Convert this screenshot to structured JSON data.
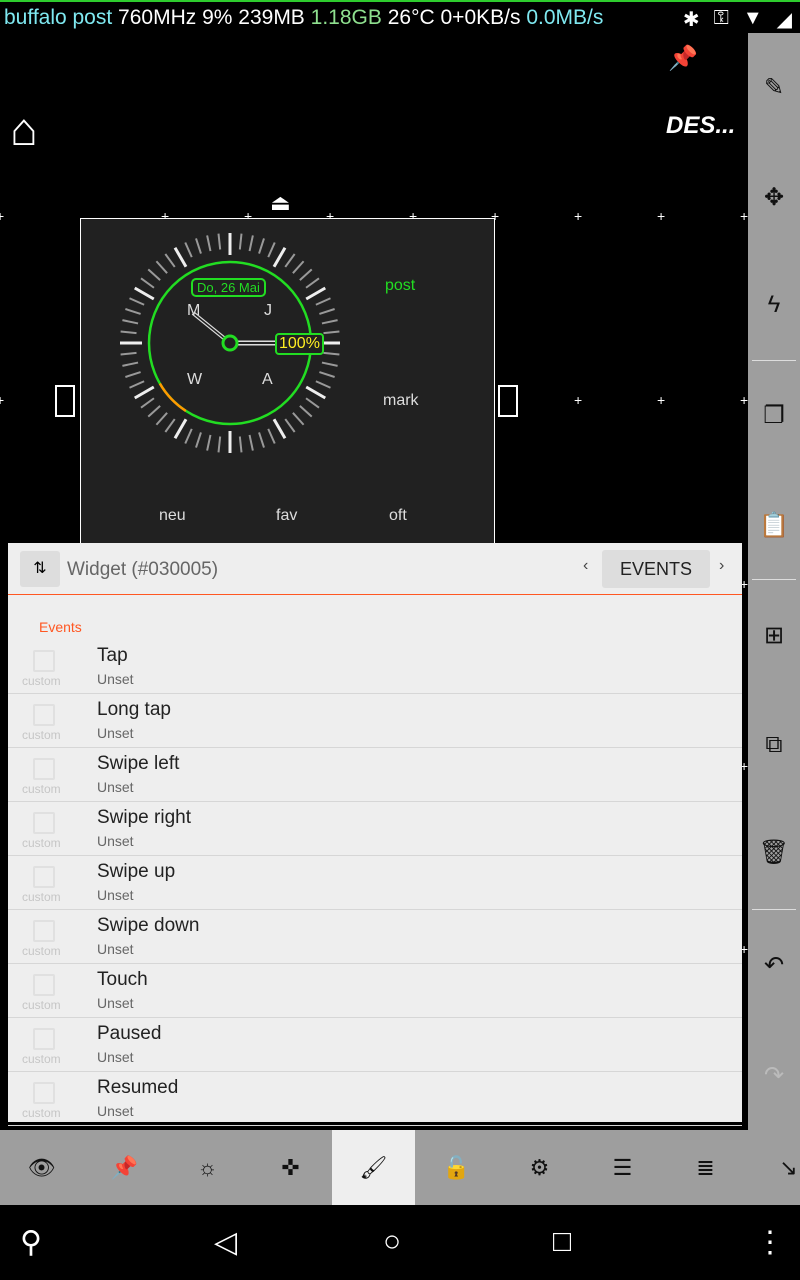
{
  "status": {
    "app_overlay": "buffalo post",
    "cpu": "760MHz 9%",
    "mem": "239MB",
    "storage": "1.18GB",
    "temp": "26°C",
    "net": "0+0KB/s",
    "disk": "0.0MB/s",
    "icons": [
      "bluetooth-icon",
      "vpn-key-icon",
      "wifi-icon",
      "signal-icon"
    ]
  },
  "canvas": {
    "title": "DES...",
    "home_icon": "home-icon",
    "pin_icon": "pin-icon"
  },
  "widget": {
    "date": "Do, 26 Mai",
    "battery": "100%",
    "letters": [
      "M",
      "J",
      "W",
      "A"
    ],
    "labels": {
      "post": "post",
      "mark": "mark",
      "neu": "neu",
      "fav": "fav",
      "oft": "oft"
    },
    "colors": {
      "ring": "#22dd22",
      "battery_text": "#ffee22",
      "arc": "#ff9900"
    }
  },
  "panel": {
    "title": "Widget (#030005)",
    "tab": "EVENTS",
    "section": "Events",
    "items": [
      {
        "name": "Tap",
        "value": "Unset",
        "tag": "custom"
      },
      {
        "name": "Long tap",
        "value": "Unset",
        "tag": "custom"
      },
      {
        "name": "Swipe left",
        "value": "Unset",
        "tag": "custom"
      },
      {
        "name": "Swipe right",
        "value": "Unset",
        "tag": "custom"
      },
      {
        "name": "Swipe up",
        "value": "Unset",
        "tag": "custom"
      },
      {
        "name": "Swipe down",
        "value": "Unset",
        "tag": "custom"
      },
      {
        "name": "Touch",
        "value": "Unset",
        "tag": "custom"
      },
      {
        "name": "Paused",
        "value": "Unset",
        "tag": "custom"
      },
      {
        "name": "Resumed",
        "value": "Unset",
        "tag": "custom"
      }
    ],
    "accent": "#ff5722"
  },
  "sidebar": [
    "edit-icon",
    "move-icon",
    "flash-icon",
    "copy-icon",
    "paste-icon",
    "add-icon",
    "add-multiple-icon",
    "delete-icon",
    "undo-icon",
    "redo-icon"
  ],
  "toolbar": {
    "items": [
      "eye-icon",
      "pin-icon",
      "brightness-icon",
      "gamepad-icon",
      "brush-icon",
      "lock-icon",
      "settings-icon",
      "tune-icon",
      "list-icon",
      "resize-icon"
    ],
    "selected": "brush-icon"
  },
  "nav": [
    "search-icon",
    "back-icon",
    "home-icon",
    "recents-icon",
    "menu-icon"
  ]
}
